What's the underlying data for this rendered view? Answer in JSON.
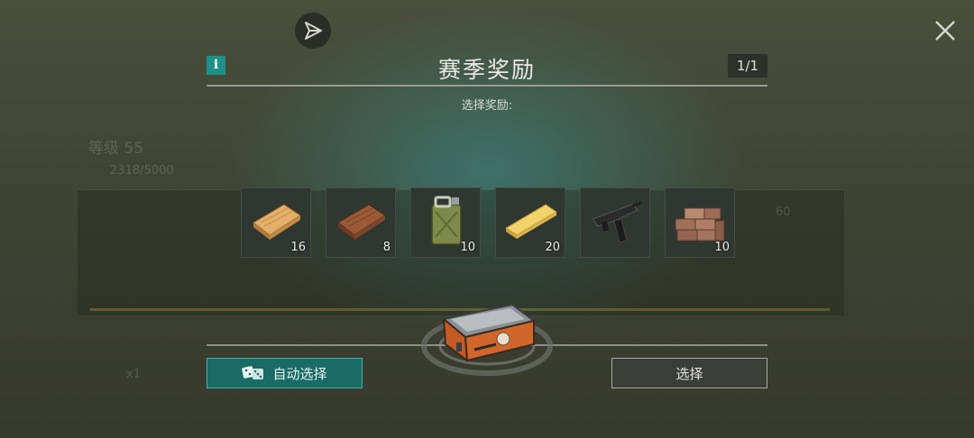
{
  "dialog": {
    "title": "赛季奖励",
    "page_counter": "1/1",
    "subtitle": "选择奖励:",
    "info_icon": "i"
  },
  "rewards": [
    {
      "name": "light-wood-plank-icon",
      "quantity": "16"
    },
    {
      "name": "dark-wood-plank-icon",
      "quantity": "8"
    },
    {
      "name": "fuel-jerrycan-icon",
      "quantity": "10"
    },
    {
      "name": "yellow-wood-plank-icon",
      "quantity": "20"
    },
    {
      "name": "submachine-gun-icon",
      "quantity": ""
    },
    {
      "name": "brick-pile-icon",
      "quantity": "10"
    }
  ],
  "buttons": {
    "auto_select": "自动选择",
    "select": "选择"
  },
  "background": {
    "level": "等级 55",
    "progress": "2318/5000",
    "count": "x1",
    "cost": "60"
  },
  "colors": {
    "accent_teal": "#1a6b66",
    "teal_border": "#3fb3aa",
    "chest_orange": "#d2662a"
  }
}
